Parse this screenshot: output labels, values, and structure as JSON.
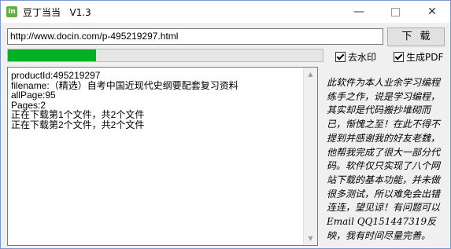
{
  "window": {
    "title": "豆丁当当   V1.3",
    "icon_glyph": "in",
    "minimize_glyph": "—",
    "close_glyph": "✕"
  },
  "url_input": {
    "value": "http://www.docin.com/p-495219297.html"
  },
  "download_button": {
    "label": "下载"
  },
  "progress": {
    "fraction": 0.28,
    "color": "#06b025"
  },
  "options": {
    "remove_watermark": {
      "label": "去水印",
      "checked": true
    },
    "generate_pdf": {
      "label": "生成PDF",
      "checked": true
    }
  },
  "log": {
    "lines": [
      "productId:495219297",
      "filename:（精选）自考中国近现代史纲要配套复习资料",
      "allPage:95",
      "Pages:2",
      "正在下载第1个文件，共2个文件",
      "正在下载第2个文件，共2个文件"
    ]
  },
  "scrollbar": {
    "up_glyph": "▲",
    "down_glyph": "▼"
  },
  "side_note": {
    "text": "此软件为本人业余学习编程练手之作，说是学习编程，其实却是代码搬抄堆砌而已，惭愧之至！在此不得不提到并感谢我的好友老魏，他帮我完成了很大一部分代码。软件仅只实现了八个网站下载的基本功能，并未做很多测试，所以难免会出错连连，望见谅！有问题可以Email QQ151447319反映，我有时间尽量完善。"
  }
}
